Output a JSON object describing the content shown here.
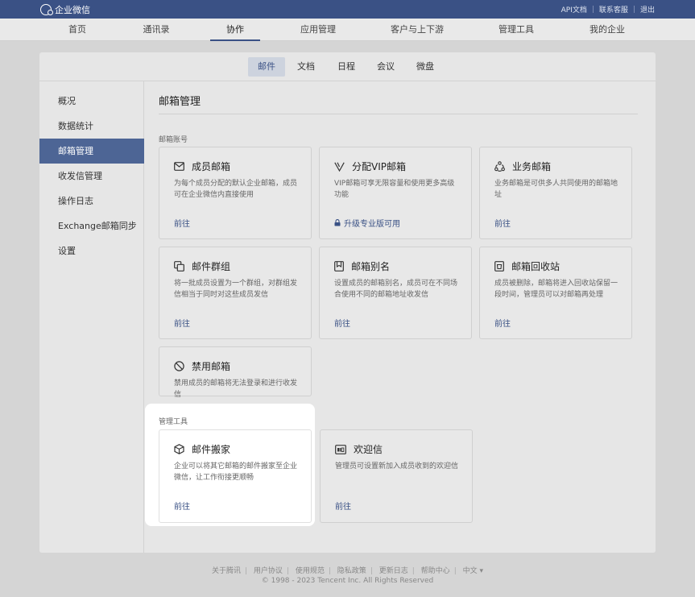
{
  "topbar": {
    "brand": "企业微信",
    "links": [
      "API文档",
      "联系客服",
      "退出"
    ]
  },
  "nav": {
    "items": [
      "首页",
      "通讯录",
      "协作",
      "应用管理",
      "客户与上下游",
      "管理工具",
      "我的企业"
    ],
    "active": "协作"
  },
  "subtabs": {
    "items": [
      "邮件",
      "文档",
      "日程",
      "会议",
      "微盘"
    ],
    "active": "邮件"
  },
  "sidebar": {
    "items": [
      "概况",
      "数据统计",
      "邮箱管理",
      "收发信管理",
      "操作日志",
      "Exchange邮箱同步",
      "设置"
    ],
    "active": "邮箱管理"
  },
  "main": {
    "title": "邮箱管理",
    "section_accounts": "邮箱账号",
    "section_tools": "管理工具"
  },
  "tiles": [
    {
      "icon": "mail-icon",
      "title": "成员邮箱",
      "desc": "为每个成员分配的默认企业邮箱，成员可在企业微信内直接使用",
      "link": "前往"
    },
    {
      "icon": "vip-icon",
      "title": "分配VIP邮箱",
      "desc": "VIP邮箱可享无限容量和使用更多高级功能",
      "link": "升级专业版可用"
    },
    {
      "icon": "business-icon",
      "title": "业务邮箱",
      "desc": "业务邮箱是可供多人共同使用的邮箱地址",
      "link": "前往"
    },
    {
      "icon": "group-icon",
      "title": "邮件群组",
      "desc": "将一批成员设置为一个群组，对群组发信相当于同时对这些成员发信",
      "link": "前往"
    },
    {
      "icon": "alias-icon",
      "title": "邮箱别名",
      "desc": "设置成员的邮箱别名，成员可在不同场合使用不同的邮箱地址收发信",
      "link": "前往"
    },
    {
      "icon": "recycle-icon",
      "title": "邮箱回收站",
      "desc": "成员被删除，邮箱将进入回收站保留一段时间，管理员可以对邮箱再处理",
      "link": "前往"
    },
    {
      "icon": "ban-icon",
      "title": "禁用邮箱",
      "desc": "禁用成员的邮箱将无法登录和进行收发信",
      "link": ""
    },
    {
      "icon": "box-icon",
      "title": "邮件搬家",
      "desc": "企业可以将其它邮箱的邮件搬家至企业微信，让工作衔接更顺畅",
      "link": "前往"
    },
    {
      "icon": "welcome-icon",
      "title": "欢迎信",
      "desc": "管理员可设置新加入成员收到的欢迎信",
      "link": "前往"
    }
  ],
  "footer": {
    "links": [
      "关于腾讯",
      "用户协议",
      "使用规范",
      "隐私政策",
      "更新日志",
      "帮助中心",
      "中文 ▾"
    ],
    "copyright": "© 1998 - 2023 Tencent Inc. All Rights Reserved"
  },
  "colors": {
    "brand_blue": "#3a5185",
    "sidebar_active": "#4d6595"
  }
}
